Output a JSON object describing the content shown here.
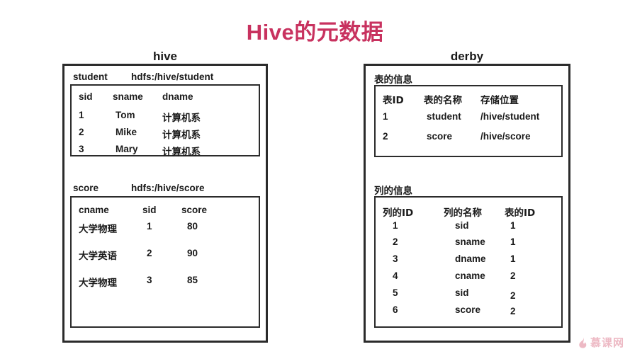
{
  "title": "Hive的元数据",
  "accent_color": "#c8325f",
  "panels": {
    "left": {
      "caption": "hive",
      "sections": [
        {
          "name": "student",
          "path": "hdfs:/hive/student",
          "columns": [
            "sid",
            "sname",
            "dname"
          ],
          "rows": [
            [
              "1",
              "Tom",
              "计算机系"
            ],
            [
              "2",
              "Mike",
              "计算机系"
            ],
            [
              "3",
              "Mary",
              "计算机系"
            ]
          ]
        },
        {
          "name": "score",
          "path": "hdfs:/hive/score",
          "columns": [
            "cname",
            "sid",
            "score"
          ],
          "rows": [
            [
              "大学物理",
              "1",
              "80"
            ],
            [
              "大学英语",
              "2",
              "90"
            ],
            [
              "大学物理",
              "3",
              "85"
            ]
          ]
        }
      ]
    },
    "right": {
      "caption": "derby",
      "sections": [
        {
          "name": "表的信息",
          "path": "",
          "columns": [
            "表ID",
            "表的名称",
            "存储位置"
          ],
          "rows": [
            [
              "1",
              "student",
              "/hive/student"
            ],
            [
              "2",
              "score",
              "/hive/score"
            ]
          ]
        },
        {
          "name": "列的信息",
          "path": "",
          "columns": [
            "列的ID",
            "列的名称",
            "表的ID"
          ],
          "rows": [
            [
              "1",
              "sid",
              "1"
            ],
            [
              "2",
              "sname",
              "1"
            ],
            [
              "3",
              "dname",
              "1"
            ],
            [
              "4",
              "cname",
              "2"
            ],
            [
              "5",
              "sid",
              "2"
            ],
            [
              "6",
              "score",
              "2"
            ]
          ]
        }
      ]
    }
  },
  "watermark": {
    "text": "慕课网",
    "icon": "flame-icon",
    "color": "#edb9c4"
  }
}
